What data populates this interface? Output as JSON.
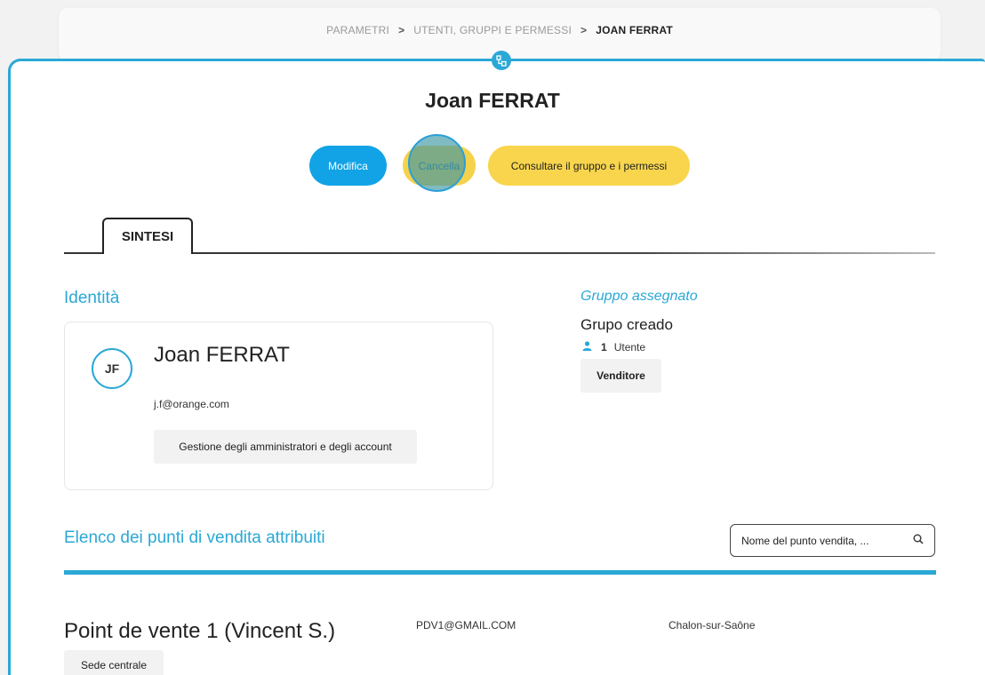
{
  "breadcrumb": {
    "items": [
      "PARAMETRI",
      "UTENTI, GRUPPI E PERMESSI"
    ],
    "current": "JOAN FERRAT",
    "separator": ">"
  },
  "header": {
    "title": "Joan FERRAT",
    "icon": "org-chart-icon"
  },
  "actions": {
    "modifica": "Modifica",
    "cancella": "Cancella",
    "consultare": "Consultare il gruppo e i permessi"
  },
  "tabs": [
    {
      "label": "SINTESI",
      "active": true
    }
  ],
  "identity": {
    "section_title": "Identità",
    "initials": "JF",
    "name": "Joan FERRAT",
    "email": "j.f@orange.com",
    "role": "Gestione degli amministratori e degli account"
  },
  "group": {
    "section_title": "Gruppo assegnato",
    "name": "Grupo creado",
    "user_count": "1",
    "user_label": "Utente",
    "chip": "Venditore"
  },
  "points_of_sale": {
    "section_title": "Elenco dei punti di vendita attribuiti",
    "search_placeholder": "Nome del punto vendita, ...",
    "items": [
      {
        "name": "Point de vente 1 (Vincent S.)",
        "email": "PDV1@GMAIL.COM",
        "city": "Chalon-sur-Saône",
        "tag": "Sede centrale"
      }
    ]
  },
  "colors": {
    "accent": "#2aa8d6",
    "primary_button": "#11a3e6",
    "secondary_button": "#f8d54d"
  }
}
